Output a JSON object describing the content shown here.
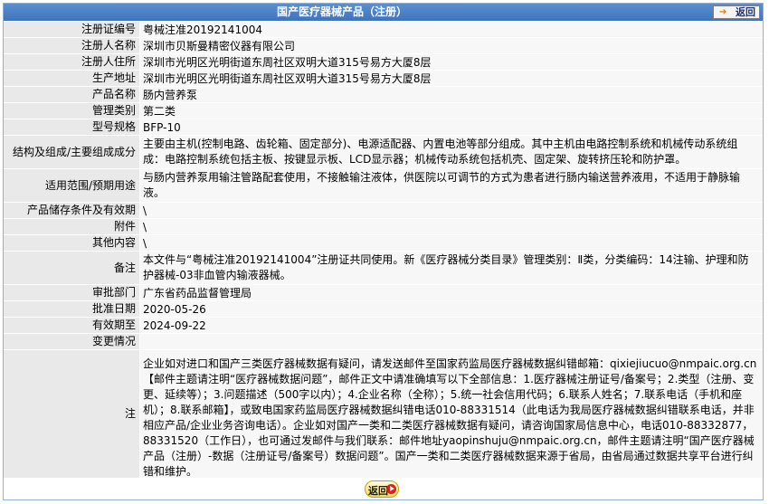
{
  "header": {
    "title": "国产医疗器械产品（注册）",
    "back_label": "返回",
    "back_icon": "arrow-right-icon"
  },
  "fields": {
    "reg_no": {
      "label": "注册证编号",
      "value": "粤械注准20192141004"
    },
    "registrant": {
      "label": "注册人名称",
      "value": "深圳市贝斯曼精密仪器有限公司"
    },
    "registrant_address": {
      "label": "注册人住所",
      "value": "深圳市光明区光明街道东周社区双明大道315号易方大厦8层"
    },
    "production_address": {
      "label": "生产地址",
      "value": "深圳市光明区光明街道东周社区双明大道315号易方大厦8层"
    },
    "product_name": {
      "label": "产品名称",
      "value": "肠内营养泵"
    },
    "category": {
      "label": "管理类别",
      "value": "第二类"
    },
    "model": {
      "label": "型号规格",
      "value": "BFP-10"
    },
    "composition": {
      "label": "结构及组成/主要组成成分",
      "value": "主要由主机(控制电路、齿轮箱、固定部分)、电源适配器、内置电池等部分组成。其中主机由电路控制系统和机械传动系统组成：电路控制系统包括主板、按键显示板、LCD显示器；机械传动系统包括机壳、固定架、旋转挤压轮和防护罩。"
    },
    "scope": {
      "label": "适用范围/预期用途",
      "value": "与肠内营养泵用输注管路配套使用，不接触输注液体，供医院以可调节的方式为患者进行肠内输送营养液用，不适用于静脉输液。"
    },
    "storage": {
      "label": "产品储存条件及有效期",
      "value": "\\"
    },
    "attachment": {
      "label": "附件",
      "value": "\\"
    },
    "other": {
      "label": "其他内容",
      "value": "\\"
    },
    "remark": {
      "label": "备注",
      "value": "本文件与“粤械注准20192141004”注册证共同使用。新《医疗器械分类目录》管理类别：Ⅱ类，分类编码：14注输、护理和防护器械-03非血管内输液器械。"
    },
    "approver": {
      "label": "审批部门",
      "value": "广东省药品监督管理局"
    },
    "approval_date": {
      "label": "批准日期",
      "value": "2020-05-26"
    },
    "valid_until": {
      "label": "有效期至",
      "value": "2024-09-22"
    },
    "changes": {
      "label": "变更情况",
      "value": ""
    },
    "note": {
      "label": "注",
      "value": "企业如对进口和国产三类医疗器械数据有疑问，请发送邮件至国家药监局医疗器械数据纠错邮箱：qixiejiucuo@nmpaic.org.cn【邮件主题请注明“医疗器械数据问题”，邮件正文中请准确填写以下全部信息：1.医疗器械注册证号/备案号；2.类型（注册、变更、延续等）；3.问题描述（500字以内）；4.企业名称（全称）；5.统一社会信用代码；6.联系人姓名；7.联系电话（手机和座机）；8.联系邮箱】，或致电国家药监局医疗器械数据纠错电话010-88331514（此电话为我局医疗器械数据纠错联系电话，并非相应产品/企业业务咨询电话）。企业如对国产一类和二类医疗器械数据有疑问，请咨询国家局信息中心，电话010-88332877，88331520（工作日），也可通过发邮件与我们联系：邮件地址yaopinshuju@nmpaic.org.cn，邮件主题请注明“国产医疗器械产品（注册）-数据（注册证号/备案号）数据问题”。国产一类和二类医疗器械数据来源于省局，由省局通过数据共享平台进行纠错和维护。"
    }
  },
  "footer": {
    "back_label": "返回",
    "back_icon": "play-icon"
  }
}
